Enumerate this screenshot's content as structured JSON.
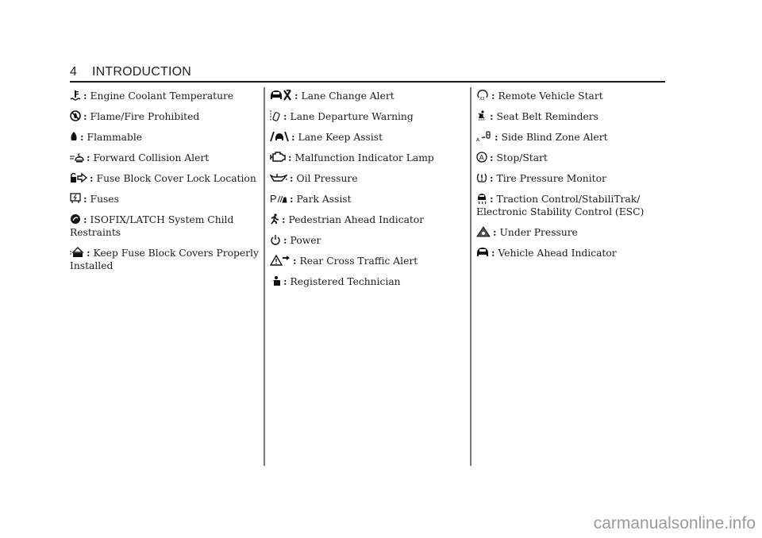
{
  "header": {
    "page_number": "4",
    "section_title": "INTRODUCTION"
  },
  "separator": ":",
  "columns": [
    {
      "items": [
        {
          "icon": "engine-coolant-temperature-icon",
          "label": "Engine Coolant Temperature"
        },
        {
          "icon": "flame-fire-prohibited-icon",
          "label": "Flame/Fire Prohibited"
        },
        {
          "icon": "flammable-icon",
          "label": "Flammable"
        },
        {
          "icon": "forward-collision-alert-icon",
          "label": "Forward Collision Alert"
        },
        {
          "icon": "fuse-block-cover-lock-icon",
          "label": "Fuse Block Cover Lock Location"
        },
        {
          "icon": "fuses-icon",
          "label": "Fuses"
        },
        {
          "icon": "isofix-latch-icon",
          "label": "ISOFIX/LATCH System Child Restraints"
        },
        {
          "icon": "keep-fuse-covers-installed-icon",
          "label": "Keep Fuse Block Covers Properly Installed"
        }
      ]
    },
    {
      "items": [
        {
          "icon": "lane-change-alert-icon",
          "label": "Lane Change Alert"
        },
        {
          "icon": "lane-departure-warning-icon",
          "label": "Lane Departure Warning"
        },
        {
          "icon": "lane-keep-assist-icon",
          "label": "Lane Keep Assist"
        },
        {
          "icon": "malfunction-indicator-lamp-icon",
          "label": "Malfunction Indicator Lamp"
        },
        {
          "icon": "oil-pressure-icon",
          "label": "Oil Pressure"
        },
        {
          "icon": "park-assist-icon",
          "label": "Park Assist"
        },
        {
          "icon": "pedestrian-ahead-icon",
          "label": "Pedestrian Ahead Indicator"
        },
        {
          "icon": "power-icon",
          "label": "Power"
        },
        {
          "icon": "rear-cross-traffic-alert-icon",
          "label": "Rear Cross Traffic Alert"
        },
        {
          "icon": "registered-technician-icon",
          "label": "Registered Technician"
        }
      ]
    },
    {
      "items": [
        {
          "icon": "remote-vehicle-start-icon",
          "label": "Remote Vehicle Start"
        },
        {
          "icon": "seat-belt-reminder-icon",
          "label": "Seat Belt Reminders"
        },
        {
          "icon": "side-blind-zone-alert-icon",
          "label": "Side Blind Zone Alert"
        },
        {
          "icon": "stop-start-icon",
          "label": "Stop/Start"
        },
        {
          "icon": "tire-pressure-monitor-icon",
          "label": "Tire Pressure Monitor"
        },
        {
          "icon": "traction-control-icon",
          "label": "Traction Control/StabiliTrak/ Electronic Stability Control (ESC)"
        },
        {
          "icon": "under-pressure-icon",
          "label": "Under Pressure"
        },
        {
          "icon": "vehicle-ahead-icon",
          "label": "Vehicle Ahead Indicator"
        }
      ]
    }
  ],
  "watermark": "carmanualsonline.info"
}
